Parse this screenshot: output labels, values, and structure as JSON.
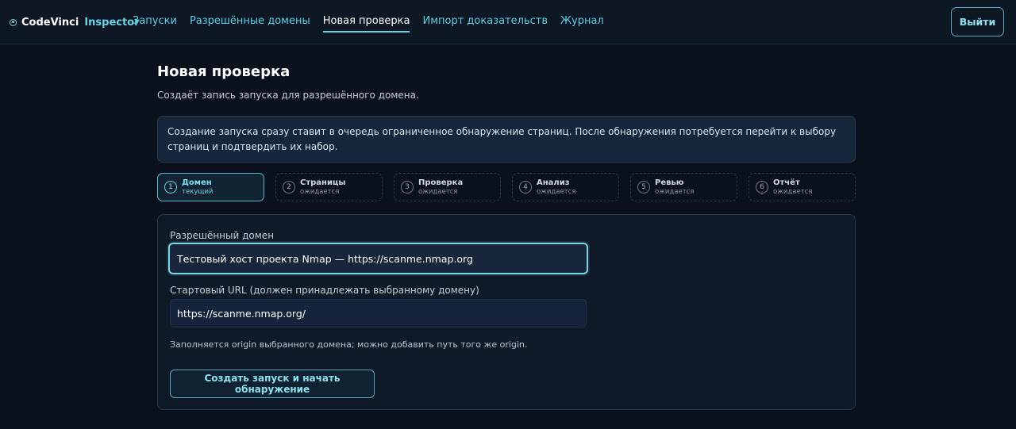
{
  "brand": {
    "name": "CodeVinci",
    "suffix": "Inspector",
    "icon": "target-dot-icon"
  },
  "nav": {
    "items": [
      {
        "label": "Запуски",
        "active": false
      },
      {
        "label": "Разрешённые домены",
        "active": false
      },
      {
        "label": "Новая проверка",
        "active": true
      },
      {
        "label": "Импорт доказательств",
        "active": false
      },
      {
        "label": "Журнал",
        "active": false
      }
    ],
    "logout_label": "Выйти"
  },
  "page": {
    "title": "Новая проверка",
    "subtitle": "Создаёт запись запуска для разрешённого домена.",
    "info": "Создание запуска сразу ставит в очередь ограниченное обнаружение страниц. После обнаружения потребуется перейти к выбору страниц и подтвердить их набор."
  },
  "steps": [
    {
      "number": "1",
      "title": "Домен",
      "status": "текущий",
      "current": true
    },
    {
      "number": "2",
      "title": "Страницы",
      "status": "ожидается",
      "current": false
    },
    {
      "number": "3",
      "title": "Проверка",
      "status": "ожидается",
      "current": false
    },
    {
      "number": "4",
      "title": "Анализ",
      "status": "ожидается",
      "current": false
    },
    {
      "number": "5",
      "title": "Ревью",
      "status": "ожидается",
      "current": false
    },
    {
      "number": "6",
      "title": "Отчёт",
      "status": "ожидается",
      "current": false
    }
  ],
  "form": {
    "domain_label": "Разрешённый домен",
    "domain_value": "Тестовый хост проекта Nmap — https://scanme.nmap.org",
    "url_label": "Стартовый URL (должен принадлежать выбранному домену)",
    "url_value": "https://scanme.nmap.org/",
    "hint": "Заполняется origin выбранного домена; можно добавить путь того же origin.",
    "submit_label": "Создать запуск и начать обнаружение"
  },
  "colors": {
    "accent": "#5fcfe3",
    "background": "#0a111c",
    "focus_border": "#7ad6e6"
  }
}
